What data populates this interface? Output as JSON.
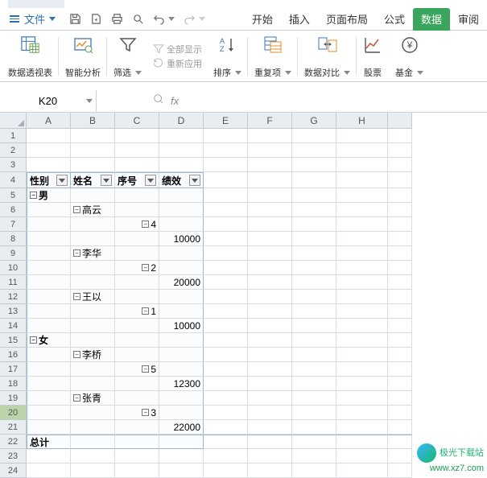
{
  "menu": {
    "file": "文件",
    "tabs": [
      "开始",
      "插入",
      "页面布局",
      "公式",
      "数据",
      "审阅"
    ],
    "active_tab": "数据"
  },
  "ribbon": {
    "pivot": "数据透视表",
    "smart": "智能分析",
    "filter": "筛选",
    "showall": "全部显示",
    "reapply": "重新应用",
    "sort": "排序",
    "dup": "重复项",
    "compare": "数据对比",
    "stock": "股票",
    "fund": "基金"
  },
  "namebox": "K20",
  "fx": "fx",
  "columns": [
    "A",
    "B",
    "C",
    "D",
    "E",
    "F",
    "G",
    "H"
  ],
  "headers": {
    "A": "性别",
    "B": "姓名",
    "C": "序号",
    "D": "绩效"
  },
  "rows": {
    "5": {
      "A": "男"
    },
    "6": {
      "B": "高云"
    },
    "7": {
      "C": "4"
    },
    "8": {
      "D": "10000"
    },
    "9": {
      "B": "李华"
    },
    "10": {
      "C": "2"
    },
    "11": {
      "D": "20000"
    },
    "12": {
      "B": "王以"
    },
    "13": {
      "C": "1"
    },
    "14": {
      "D": "10000"
    },
    "15": {
      "A": "女"
    },
    "16": {
      "B": "李桥"
    },
    "17": {
      "C": "5"
    },
    "18": {
      "D": "12300"
    },
    "19": {
      "B": "张青"
    },
    "20": {
      "C": "3"
    },
    "21": {
      "D": "22000"
    },
    "22": {
      "A": "总计"
    }
  },
  "watermark": {
    "l1": "极光下载站",
    "l2": "www.xz7.com"
  },
  "chart_data": null
}
